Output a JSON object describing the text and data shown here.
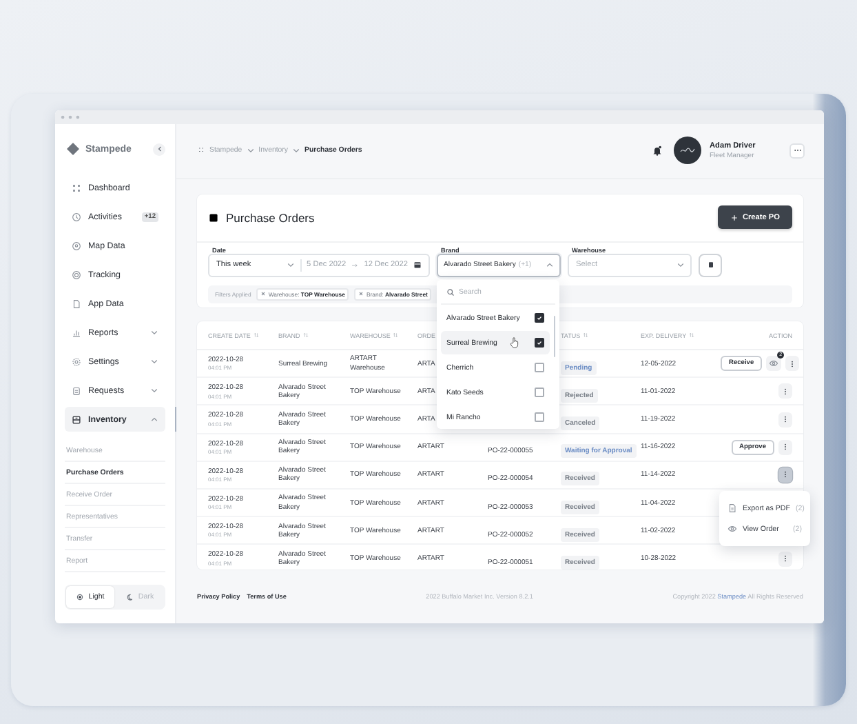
{
  "sidebar": {
    "brand": "Stampede",
    "items": [
      {
        "label": "Dashboard",
        "selected": false
      },
      {
        "label": "Activities",
        "badge": "+12",
        "selected": false
      },
      {
        "label": "Map Data",
        "selected": false
      },
      {
        "label": "Tracking",
        "selected": false
      },
      {
        "label": "App Data",
        "selected": false
      },
      {
        "label": "Reports",
        "expanded": false,
        "selected": false
      },
      {
        "label": "Settings",
        "expanded": false,
        "selected": false
      },
      {
        "label": "Requests",
        "expanded": false,
        "selected": false
      },
      {
        "label": "Inventory",
        "expanded": true,
        "selected": true,
        "children": [
          {
            "label": "Warehouse",
            "selected": false
          },
          {
            "label": "Purchase Orders",
            "selected": true
          },
          {
            "label": "Receive Order",
            "selected": false
          },
          {
            "label": "Representatives",
            "selected": false
          },
          {
            "label": "Transfer",
            "selected": false
          },
          {
            "label": "Report",
            "selected": false
          }
        ]
      }
    ],
    "theme": [
      {
        "label": "Light",
        "selected": true
      },
      {
        "label": "Dark",
        "selected": false
      }
    ]
  },
  "header": {
    "breadcrumb": [
      "Stampede",
      "Inventory",
      "Purchase Orders"
    ],
    "user": {
      "name": "Adam Driver",
      "role": "Fleet Manager"
    }
  },
  "page": {
    "title": "Purchase Orders",
    "create_button": "Create PO"
  },
  "filters": {
    "date": {
      "label": "Date",
      "period": "This week",
      "start": "5 Dec 2022",
      "end": "12 Dec 2022"
    },
    "brand": {
      "label": "Brand",
      "value": "Alvarado Street Bakery",
      "extra": "(+1)",
      "expanded": true
    },
    "warehouse": {
      "label": "Warehouse",
      "placeholder": "Select"
    },
    "applied_label": "Filters Applied",
    "chips": [
      "Warehouse: **TOP Warehouse**",
      "Brand: **Alvarado Street**"
    ]
  },
  "brand_dropdown": {
    "placeholder": "Search",
    "options": [
      {
        "label": "Alvarado Street Bakery",
        "checked": true,
        "highlighted": false
      },
      {
        "label": "Surreal Brewing",
        "checked": true,
        "highlighted": true
      },
      {
        "label": "Cherrich",
        "checked": false,
        "highlighted": false
      },
      {
        "label": "Kato Seeds",
        "checked": false,
        "highlighted": false
      },
      {
        "label": "Mi Rancho",
        "checked": false,
        "highlighted": false
      }
    ]
  },
  "table": {
    "columns": {
      "create_date": "CREATE DATE",
      "brand": "BRAND",
      "warehouse": "WAREHOUSE",
      "order": "ORDE",
      "status": "TATUS",
      "exp_delivery": "EXP. DELIVERY",
      "action": "ACTION"
    },
    "rows": [
      {
        "date": "2022-10-28",
        "time": "04:01 PM",
        "brand": "Surreal Brewing",
        "warehouse": "ARTART Warehouse",
        "order": "ARTA",
        "status": "Pending",
        "color": "#6a8cc4",
        "delivery": "12-05-2022",
        "button": "Receive",
        "views": "2",
        "menu_active": false
      },
      {
        "date": "2022-10-28",
        "time": "04:01 PM",
        "brand": "Alvarado Street Bakery",
        "warehouse": "TOP Warehouse",
        "order": "ARTA",
        "status": "Rejected",
        "color": "#7a8089",
        "delivery": "11-01-2022",
        "menu_active": false
      },
      {
        "date": "2022-10-28",
        "time": "04:01 PM",
        "brand": "Alvarado Street Bakery",
        "warehouse": "TOP Warehouse",
        "order": "ARTA",
        "status": "Canceled",
        "color": "#7a8089",
        "delivery": "11-19-2022",
        "menu_active": false
      },
      {
        "date": "2022-10-28",
        "time": "04:01 PM",
        "brand": "Alvarado Street Bakery",
        "warehouse": "TOP Warehouse",
        "order": "ARTART",
        "po": "PO-22-000055",
        "status": "Waiting for Approval",
        "color": "#6a8cc4",
        "delivery": "11-16-2022",
        "button": "Approve",
        "menu_active": false
      },
      {
        "date": "2022-10-28",
        "time": "04:01 PM",
        "brand": "Alvarado Street Bakery",
        "warehouse": "TOP Warehouse",
        "order": "ARTART",
        "po": "PO-22-000054",
        "status": "Received",
        "color": "#7a8089",
        "delivery": "11-14-2022",
        "menu_active": true
      },
      {
        "date": "2022-10-28",
        "time": "04:01 PM",
        "brand": "Alvarado Street Bakery",
        "warehouse": "TOP Warehouse",
        "order": "ARTART",
        "po": "PO-22-000053",
        "status": "Received",
        "color": "#7a8089",
        "delivery": "11-04-2022"
      },
      {
        "date": "2022-10-28",
        "time": "04:01 PM",
        "brand": "Alvarado Street Bakery",
        "warehouse": "TOP Warehouse",
        "order": "ARTART",
        "po": "PO-22-000052",
        "status": "Received",
        "color": "#7a8089",
        "delivery": "11-02-2022"
      },
      {
        "date": "2022-10-28",
        "time": "04:01 PM",
        "brand": "Alvarado Street Bakery",
        "warehouse": "TOP Warehouse",
        "order": "ARTART",
        "po": "PO-22-000051",
        "status": "Received",
        "color": "#7a8089",
        "delivery": "10-28-2022",
        "menu_active": false
      }
    ]
  },
  "context_menu": [
    {
      "label": "Export as PDF",
      "shortcut": "(2)"
    },
    {
      "label": "View Order",
      "shortcut": "(2)"
    }
  ],
  "footer": {
    "links": [
      "Privacy Policy",
      "Terms of Use"
    ],
    "version": "2022 Buffalo Market Inc. Version 8.2.1",
    "copyright_before": "Copyright 2022",
    "copyright_link": "Stampede",
    "copyright_after": "All Rights Reserved"
  }
}
